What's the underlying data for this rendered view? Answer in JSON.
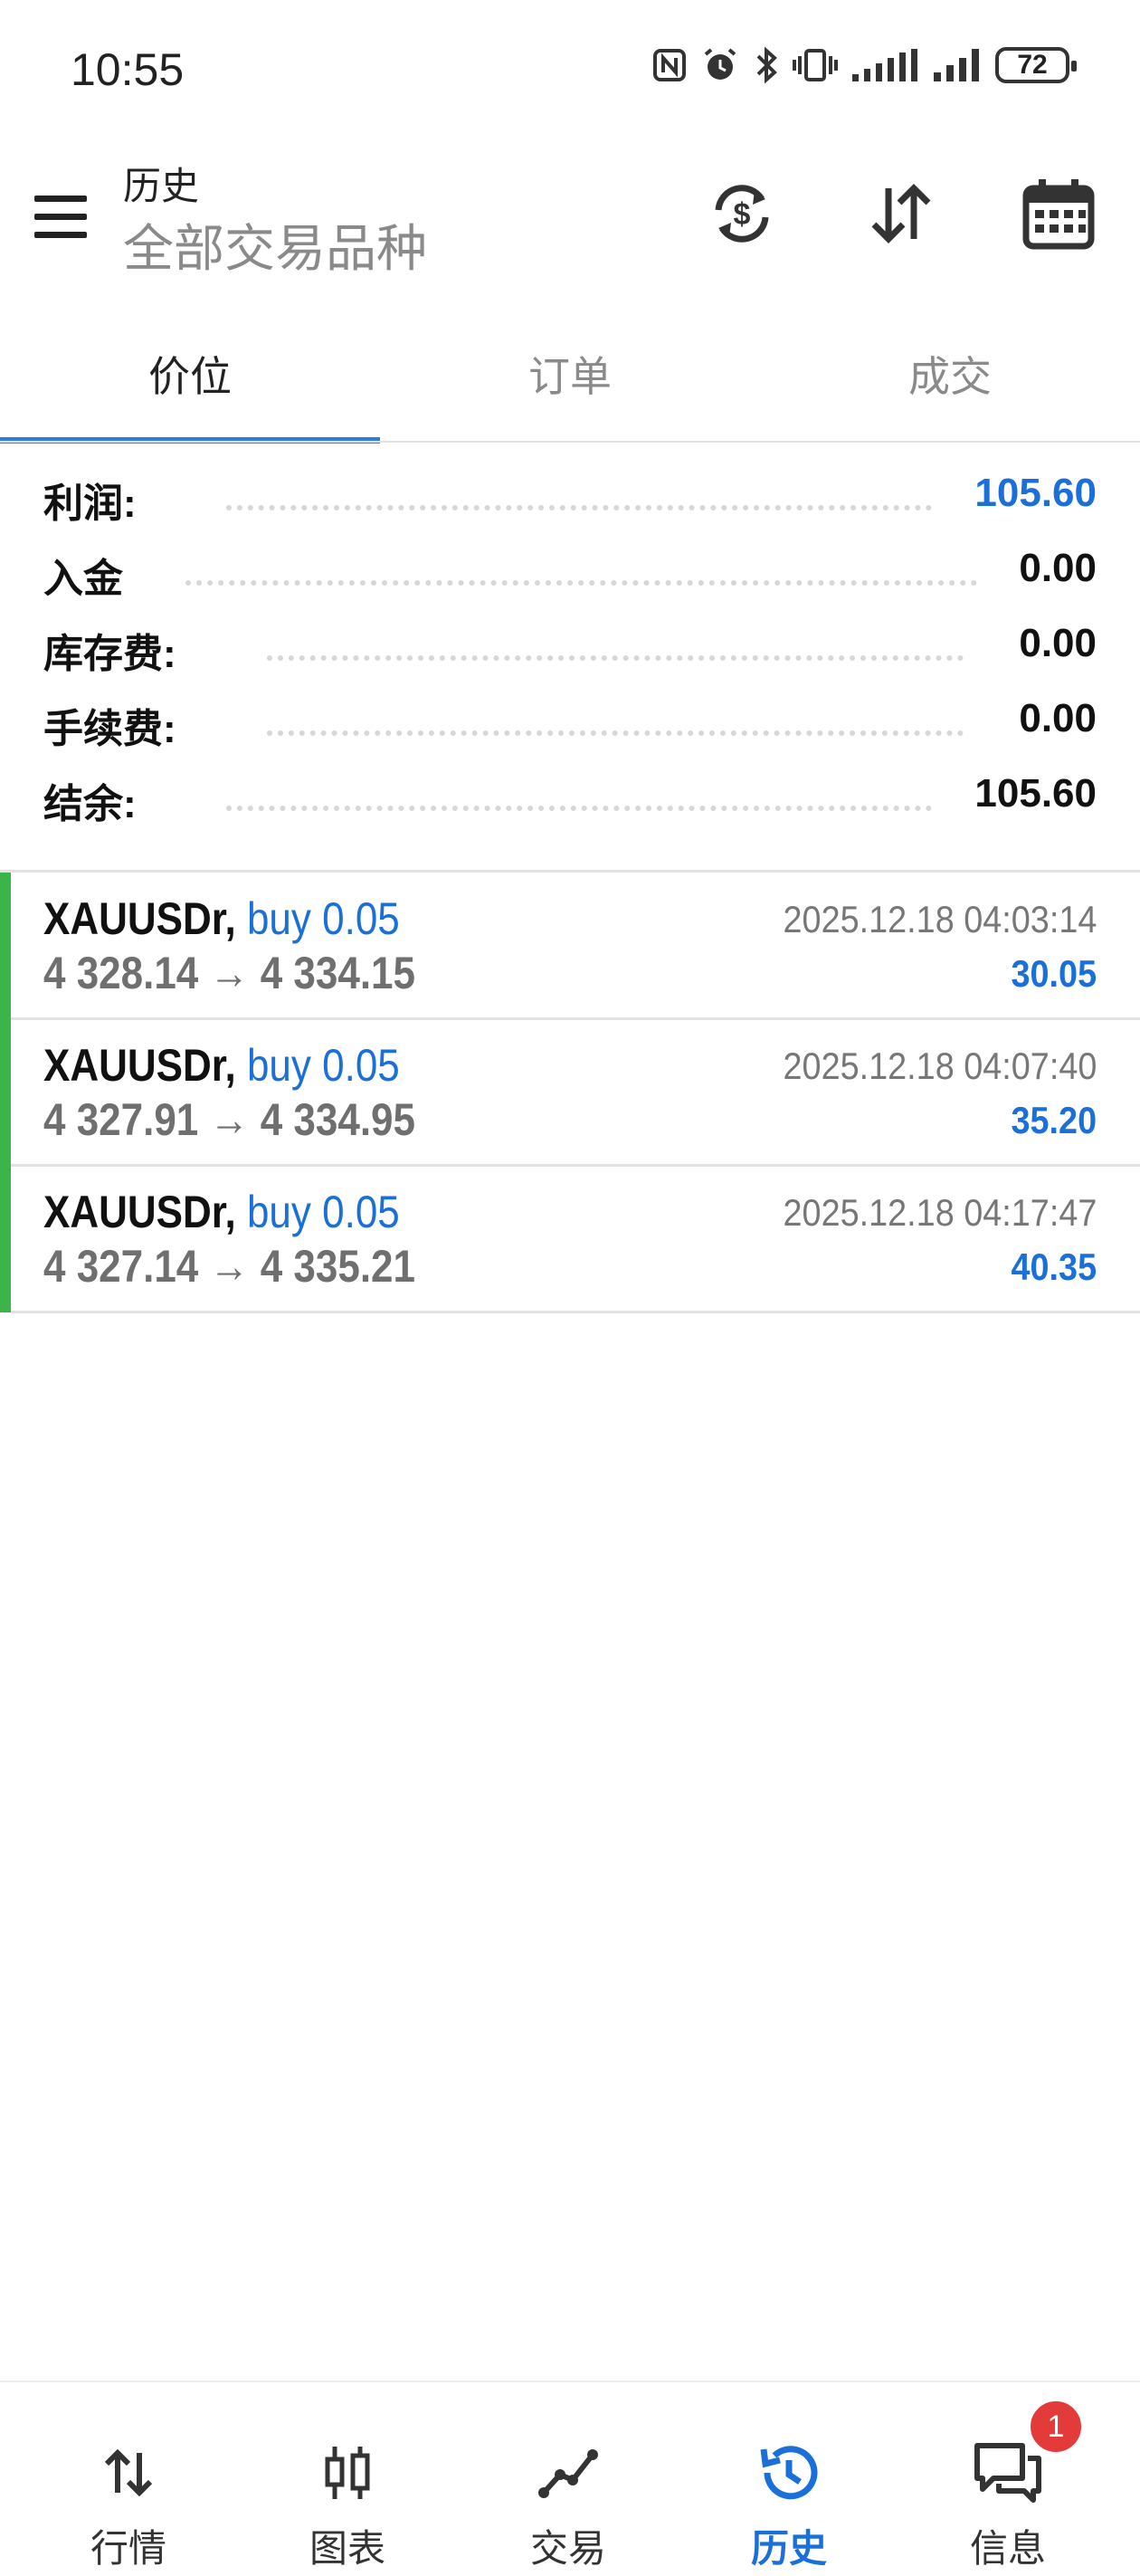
{
  "status_bar": {
    "time": "10:55",
    "battery": "72"
  },
  "header": {
    "title": "历史",
    "subtitle": "全部交易品种"
  },
  "tabs": [
    {
      "label": "价位",
      "active": true
    },
    {
      "label": "订单",
      "active": false
    },
    {
      "label": "成交",
      "active": false
    }
  ],
  "summary": {
    "profit": {
      "label": "利润:",
      "value": "105.60"
    },
    "deposit": {
      "label": "入金",
      "value": "0.00"
    },
    "swap": {
      "label": "库存费:",
      "value": "0.00"
    },
    "commission": {
      "label": "手续费:",
      "value": "0.00"
    },
    "balance": {
      "label": "结余:",
      "value": "105.60"
    }
  },
  "deals": [
    {
      "symbol": "XAUUSDr,",
      "side": "buy 0.05",
      "prices": "4 328.14 → 4 334.15",
      "time": "2025.12.18 04:03:14",
      "profit": "30.05"
    },
    {
      "symbol": "XAUUSDr,",
      "side": "buy 0.05",
      "prices": "4 327.91 → 4 334.95",
      "time": "2025.12.18 04:07:40",
      "profit": "35.20"
    },
    {
      "symbol": "XAUUSDr,",
      "side": "buy 0.05",
      "prices": "4 327.14 → 4 335.21",
      "time": "2025.12.18 04:17:47",
      "profit": "40.35"
    }
  ],
  "bottom_nav": [
    {
      "label": "行情",
      "icon": "quotes-arrows-icon",
      "active": false
    },
    {
      "label": "图表",
      "icon": "candlestick-chart-icon",
      "active": false
    },
    {
      "label": "交易",
      "icon": "trade-line-icon",
      "active": false
    },
    {
      "label": "历史",
      "icon": "history-clock-icon",
      "active": true
    },
    {
      "label": "信息",
      "icon": "chat-messages-icon",
      "active": false
    }
  ],
  "messages_badge": "1",
  "colors": {
    "accent": "#1b6fd9",
    "buy_bar": "#3bb54a",
    "tab_indicator": "#2d7de0",
    "badge": "#e33a3a"
  }
}
